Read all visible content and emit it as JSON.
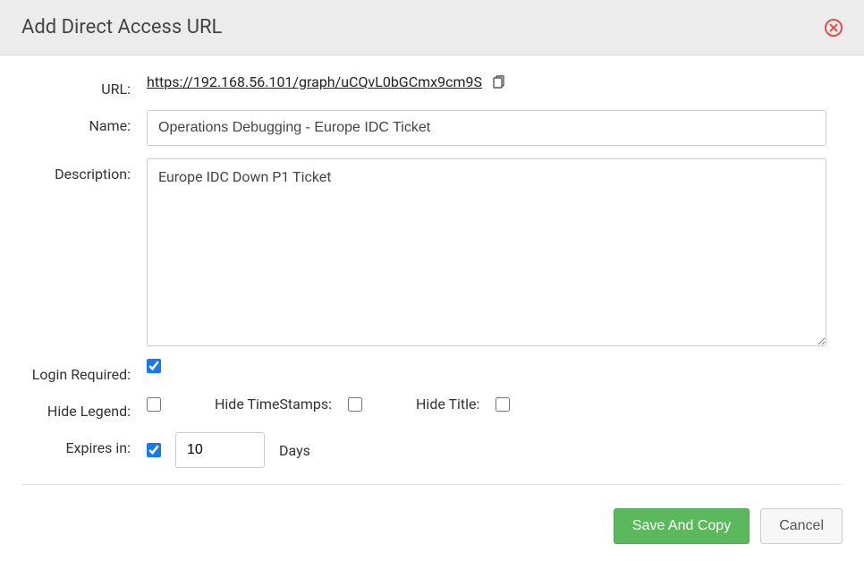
{
  "header": {
    "title": "Add Direct Access URL"
  },
  "form": {
    "url_label": "URL:",
    "url_value": "https://192.168.56.101/graph/uCQvL0bGCmx9cm9S",
    "name_label": "Name:",
    "name_value": "Operations Debugging - Europe IDC Ticket",
    "description_label": "Description:",
    "description_value": "Europe IDC Down P1 Ticket",
    "login_required_label": "Login Required:",
    "login_required_checked": true,
    "hide_legend_label": "Hide Legend:",
    "hide_legend_checked": false,
    "hide_timestamps_label": "Hide TimeStamps:",
    "hide_timestamps_checked": false,
    "hide_title_label": "Hide Title:",
    "hide_title_checked": false,
    "expires_label": "Expires in:",
    "expires_checked": true,
    "expires_value": "10",
    "expires_unit": "Days"
  },
  "footer": {
    "save_label": "Save And Copy",
    "cancel_label": "Cancel"
  }
}
